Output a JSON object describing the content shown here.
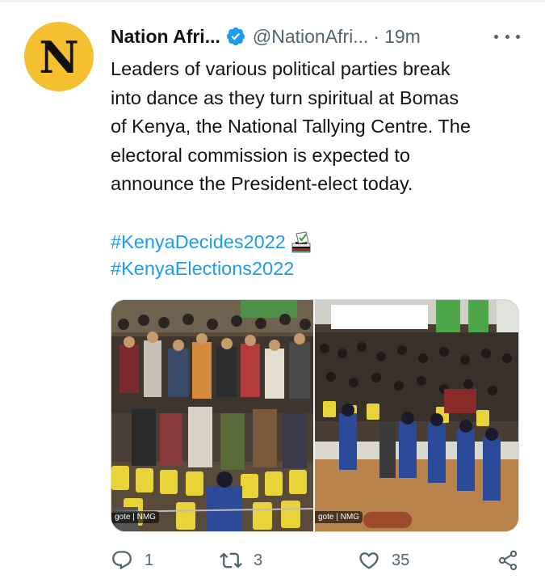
{
  "tweet": {
    "avatar_letter": "N",
    "display_name": "Nation Afri...",
    "handle": "@NationAfri...",
    "separator": "·",
    "time": "19m",
    "body_lines": [
      "Leaders of various political parties break",
      "into dance as they turn spiritual at Bomas",
      "of Kenya, the National Tallying Centre. The",
      "electoral commission is expected to",
      "announce the President-elect today."
    ],
    "hashtags": [
      "#KenyaDecides2022",
      "#KenyaElections2022"
    ],
    "photos": [
      {
        "credit": "gote | NMG"
      },
      {
        "credit": "gote | NMG"
      }
    ],
    "actions": {
      "reply_count": "1",
      "retweet_count": "3",
      "like_count": "35"
    }
  },
  "colors": {
    "link": "#1d9bf0",
    "secondary_text": "#536471",
    "avatar_bg": "#f5c02f"
  },
  "icons": [
    "verified-badge-icon",
    "more-icon",
    "ballot-box-emoji-icon",
    "reply-icon",
    "retweet-icon",
    "like-icon",
    "share-icon"
  ]
}
